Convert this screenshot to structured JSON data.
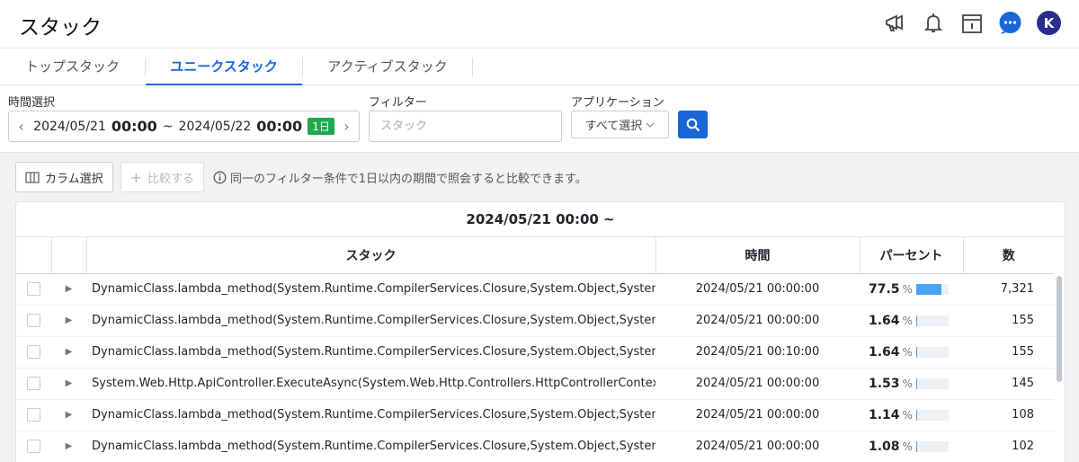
{
  "page": {
    "title": "スタック"
  },
  "colors": {
    "accent": "#1a66d9",
    "badge": "#1fa84f",
    "bar": "#4aa3f5",
    "avatar": "#2a2d8f"
  },
  "header": {
    "icons": [
      "megaphone-icon",
      "bell-icon",
      "calendar-icon",
      "chat-icon"
    ],
    "avatar_initial": "K"
  },
  "tabs": [
    {
      "label": "トップスタック",
      "active": false
    },
    {
      "label": "ユニークスタック",
      "active": true
    },
    {
      "label": "アクティブスタック",
      "active": false
    }
  ],
  "filters": {
    "time_label": "時間選択",
    "start_date": "2024/05/21",
    "start_time": "00:00",
    "separator": "~",
    "end_date": "2024/05/22",
    "end_time": "00:00",
    "duration": "1日",
    "filter_label": "フィルター",
    "filter_placeholder": "スタック",
    "app_label": "アプリケーション",
    "app_value": "すべて選択"
  },
  "toolbar": {
    "column_select": "カラム選択",
    "compare": "比較する",
    "info": "同一のフィルター条件で1日以内の期間で照会すると比較できます。"
  },
  "table": {
    "title": "2024/05/21 00:00 ~",
    "columns": {
      "stack": "スタック",
      "time": "時間",
      "percent": "パーセント",
      "count": "数"
    },
    "rows": [
      {
        "stack": "DynamicClass.lambda_method(System.Runtime.CompilerServices.Closure,System.Object,System.Object[])",
        "time": "2024/05/21 00:00:00",
        "percent": "77.5",
        "percent_value": 77.5,
        "count": "7,321"
      },
      {
        "stack": "DynamicClass.lambda_method(System.Runtime.CompilerServices.Closure,System.Object,System.Object[])",
        "time": "2024/05/21 00:00:00",
        "percent": "1.64",
        "percent_value": 1.64,
        "count": "155"
      },
      {
        "stack": "DynamicClass.lambda_method(System.Runtime.CompilerServices.Closure,System.Object,System.Object[])",
        "time": "2024/05/21 00:10:00",
        "percent": "1.64",
        "percent_value": 1.64,
        "count": "155"
      },
      {
        "stack": "System.Web.Http.ApiController.ExecuteAsync(System.Web.Http.Controllers.HttpControllerContext,System.Threading.CancellationToken)",
        "time": "2024/05/21 00:00:00",
        "percent": "1.53",
        "percent_value": 1.53,
        "count": "145"
      },
      {
        "stack": "DynamicClass.lambda_method(System.Runtime.CompilerServices.Closure,System.Object,System.Object[])",
        "time": "2024/05/21 00:00:00",
        "percent": "1.14",
        "percent_value": 1.14,
        "count": "108"
      },
      {
        "stack": "DynamicClass.lambda_method(System.Runtime.CompilerServices.Closure,System.Object,System.Object[])",
        "time": "2024/05/21 00:00:00",
        "percent": "1.08",
        "percent_value": 1.08,
        "count": "102"
      }
    ]
  }
}
